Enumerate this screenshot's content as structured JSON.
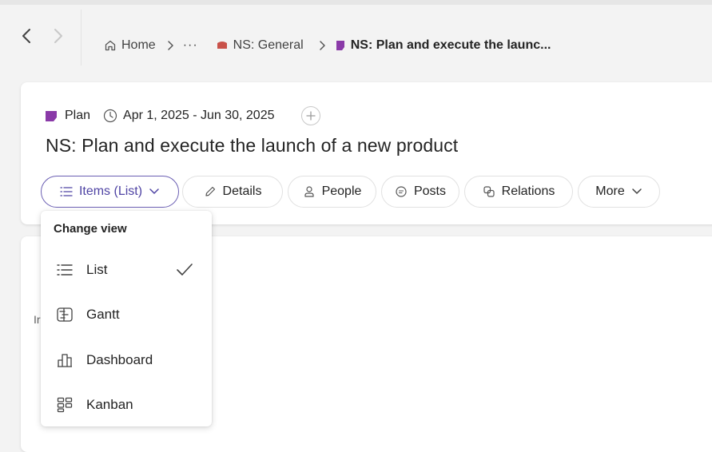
{
  "nav": {
    "breadcrumb": {
      "home": "Home",
      "ellipsis": "···",
      "general": "NS: General",
      "current": "NS: Plan and execute the launc..."
    }
  },
  "plan": {
    "type_label": "Plan",
    "date_range": "Apr 1, 2025 - Jun 30, 2025",
    "title": "NS: Plan and execute the launch of a new product"
  },
  "tabs": [
    {
      "label": "Items (List)"
    },
    {
      "label": "Details"
    },
    {
      "label": "People"
    },
    {
      "label": "Posts"
    },
    {
      "label": "Relations"
    },
    {
      "label": "More"
    }
  ],
  "background_text": "Ir",
  "view_menu": {
    "header": "Change view",
    "items": [
      {
        "label": "List",
        "icon": "list-icon",
        "selected": true
      },
      {
        "label": "Gantt",
        "icon": "gantt-icon",
        "selected": false
      },
      {
        "label": "Dashboard",
        "icon": "dashboard-icon",
        "selected": false
      },
      {
        "label": "Kanban",
        "icon": "kanban-icon",
        "selected": false
      }
    ]
  },
  "colors": {
    "accent": "#6b5fb3",
    "plan_icon": "#8a3aa8",
    "general_icon": "#c9524a"
  }
}
